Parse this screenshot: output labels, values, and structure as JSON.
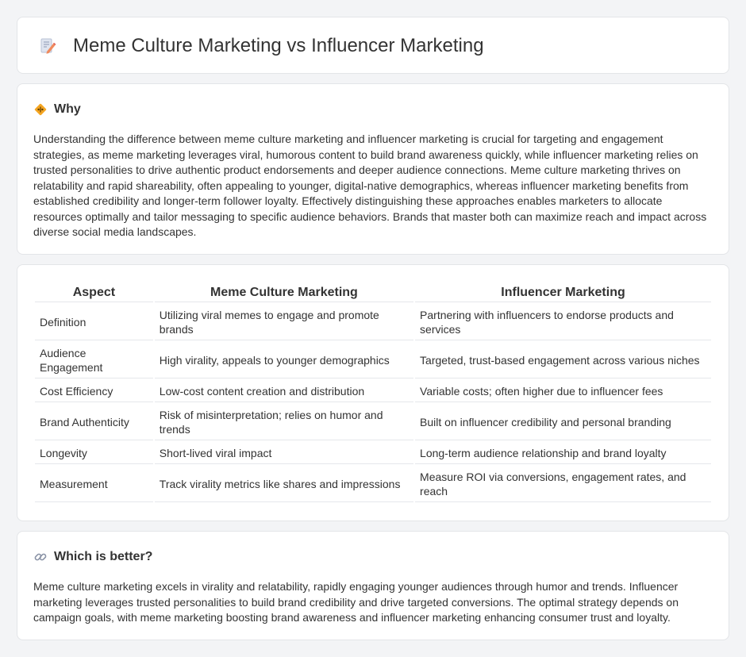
{
  "header": {
    "title": "Meme Culture Marketing vs Influencer Marketing",
    "icon": "document-pencil-icon"
  },
  "why": {
    "heading": "Why",
    "icon": "diamond-sign-icon",
    "body": "Understanding the difference between meme culture marketing and influencer marketing is crucial for targeting and engagement strategies, as meme marketing leverages viral, humorous content to build brand awareness quickly, while influencer marketing relies on trusted personalities to drive authentic product endorsements and deeper audience connections. Meme culture marketing thrives on relatability and rapid shareability, often appealing to younger, digital-native demographics, whereas influencer marketing benefits from established credibility and longer-term follower loyalty. Effectively distinguishing these approaches enables marketers to allocate resources optimally and tailor messaging to specific audience behaviors. Brands that master both can maximize reach and impact across diverse social media landscapes."
  },
  "comparison": {
    "headers": [
      "Aspect",
      "Meme Culture Marketing",
      "Influencer Marketing"
    ],
    "rows": [
      [
        "Definition",
        "Utilizing viral memes to engage and promote brands",
        "Partnering with influencers to endorse products and services"
      ],
      [
        "Audience Engagement",
        "High virality, appeals to younger demographics",
        "Targeted, trust-based engagement across various niches"
      ],
      [
        "Cost Efficiency",
        "Low-cost content creation and distribution",
        "Variable costs; often higher due to influencer fees"
      ],
      [
        "Brand Authenticity",
        "Risk of misinterpretation; relies on humor and trends",
        "Built on influencer credibility and personal branding"
      ],
      [
        "Longevity",
        "Short-lived viral impact",
        "Long-term audience relationship and brand loyalty"
      ],
      [
        "Measurement",
        "Track virality metrics like shares and impressions",
        "Measure ROI via conversions, engagement rates, and reach"
      ]
    ]
  },
  "better": {
    "heading": "Which is better?",
    "icon": "link-icon",
    "body": "Meme culture marketing excels in virality and relatability, rapidly engaging younger audiences through humor and trends. Influencer marketing leverages trusted personalities to build brand credibility and drive targeted conversions. The optimal strategy depends on campaign goals, with meme marketing boosting brand awareness and influencer marketing enhancing consumer trust and loyalty."
  },
  "colors": {
    "background": "#f3f4f6",
    "card": "#ffffff",
    "border": "#e3e5e8",
    "text": "#333333"
  }
}
